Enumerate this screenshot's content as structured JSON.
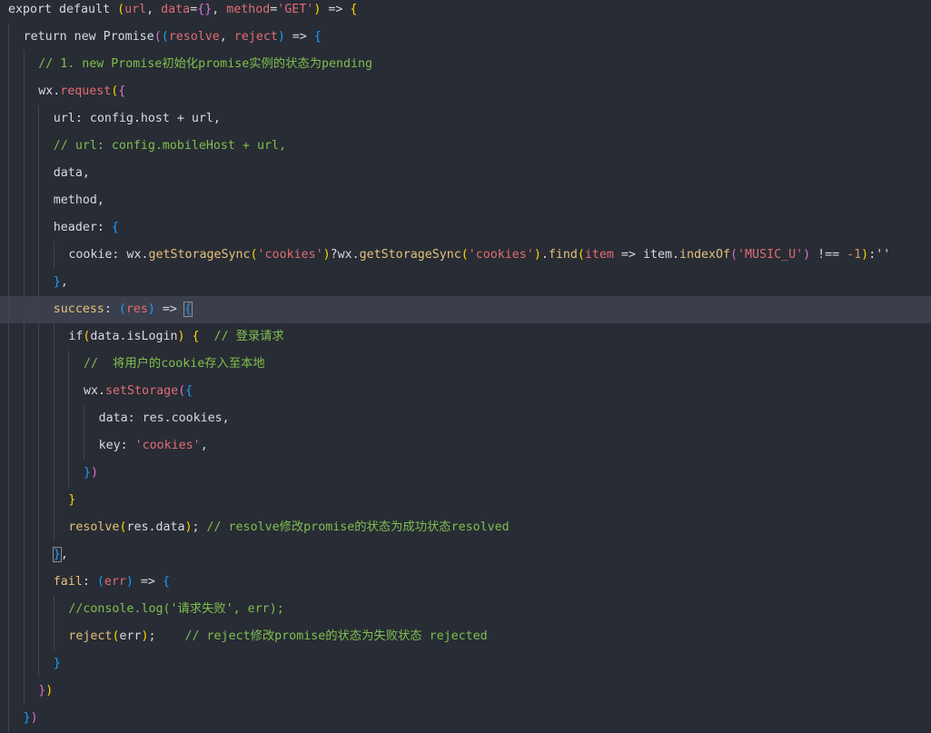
{
  "editor": {
    "active_line_index": 11,
    "lines": [
      {
        "indent": 0,
        "tokens": [
          {
            "t": "export default ",
            "c": "plain"
          },
          {
            "t": "(",
            "c": "brk"
          },
          {
            "t": "url",
            "c": "prm"
          },
          {
            "t": ", ",
            "c": "plain"
          },
          {
            "t": "data",
            "c": "prm"
          },
          {
            "t": "=",
            "c": "plain"
          },
          {
            "t": "{}",
            "c": "brk2"
          },
          {
            "t": ", ",
            "c": "plain"
          },
          {
            "t": "method",
            "c": "prm"
          },
          {
            "t": "=",
            "c": "plain"
          },
          {
            "t": "'GET'",
            "c": "str"
          },
          {
            "t": ")",
            "c": "brk"
          },
          {
            "t": " => ",
            "c": "plain"
          },
          {
            "t": "{",
            "c": "brk"
          }
        ]
      },
      {
        "indent": 1,
        "tokens": [
          {
            "t": "return new Promise",
            "c": "plain"
          },
          {
            "t": "(",
            "c": "brk2"
          },
          {
            "t": "(",
            "c": "brk3"
          },
          {
            "t": "resolve",
            "c": "prm"
          },
          {
            "t": ", ",
            "c": "plain"
          },
          {
            "t": "reject",
            "c": "prm"
          },
          {
            "t": ")",
            "c": "brk3"
          },
          {
            "t": " => ",
            "c": "plain"
          },
          {
            "t": "{",
            "c": "brk3"
          }
        ]
      },
      {
        "indent": 2,
        "tokens": [
          {
            "t": "// 1. new Promise初始化promise实例的状态为pending",
            "c": "cmt"
          }
        ]
      },
      {
        "indent": 2,
        "tokens": [
          {
            "t": "wx.",
            "c": "plain"
          },
          {
            "t": "request",
            "c": "str"
          },
          {
            "t": "(",
            "c": "brk"
          },
          {
            "t": "{",
            "c": "brk2"
          }
        ]
      },
      {
        "indent": 3,
        "tokens": [
          {
            "t": "url: config.host ",
            "c": "plain"
          },
          {
            "t": "+",
            "c": "plain"
          },
          {
            "t": " url,",
            "c": "plain"
          }
        ]
      },
      {
        "indent": 3,
        "tokens": [
          {
            "t": "// url: config.mobileHost + url,",
            "c": "cmt"
          }
        ]
      },
      {
        "indent": 3,
        "tokens": [
          {
            "t": "data,",
            "c": "plain"
          }
        ]
      },
      {
        "indent": 3,
        "tokens": [
          {
            "t": "method,",
            "c": "plain"
          }
        ]
      },
      {
        "indent": 3,
        "tokens": [
          {
            "t": "header: ",
            "c": "plain"
          },
          {
            "t": "{",
            "c": "brk3"
          }
        ]
      },
      {
        "indent": 4,
        "tokens": [
          {
            "t": "cookie: wx.",
            "c": "plain"
          },
          {
            "t": "getStorageSync",
            "c": "fn"
          },
          {
            "t": "(",
            "c": "brk"
          },
          {
            "t": "'cookies'",
            "c": "str"
          },
          {
            "t": ")",
            "c": "brk"
          },
          {
            "t": "?wx.",
            "c": "plain"
          },
          {
            "t": "getStorageSync",
            "c": "fn"
          },
          {
            "t": "(",
            "c": "brk"
          },
          {
            "t": "'cookies'",
            "c": "str"
          },
          {
            "t": ")",
            "c": "brk"
          },
          {
            "t": ".",
            "c": "plain"
          },
          {
            "t": "find",
            "c": "fn"
          },
          {
            "t": "(",
            "c": "brk"
          },
          {
            "t": "item",
            "c": "prm"
          },
          {
            "t": " => item.",
            "c": "plain"
          },
          {
            "t": "indexOf",
            "c": "fn"
          },
          {
            "t": "(",
            "c": "brk2"
          },
          {
            "t": "'MUSIC_U'",
            "c": "str"
          },
          {
            "t": ")",
            "c": "brk2"
          },
          {
            "t": " !== ",
            "c": "plain"
          },
          {
            "t": "-1",
            "c": "num"
          },
          {
            "t": ")",
            "c": "brk"
          },
          {
            "t": ":''",
            "c": "plain"
          }
        ]
      },
      {
        "indent": 3,
        "tokens": [
          {
            "t": "}",
            "c": "brk3"
          },
          {
            "t": ",",
            "c": "plain"
          }
        ]
      },
      {
        "indent": 3,
        "tokens": [
          {
            "t": "success",
            "c": "fn"
          },
          {
            "t": ": ",
            "c": "plain"
          },
          {
            "t": "(",
            "c": "brk3"
          },
          {
            "t": "res",
            "c": "prm"
          },
          {
            "t": ")",
            "c": "brk3"
          },
          {
            "t": " => ",
            "c": "plain"
          },
          {
            "t": "{",
            "c": "brk3",
            "box": true
          }
        ]
      },
      {
        "indent": 4,
        "tokens": [
          {
            "t": "if",
            "c": "plain"
          },
          {
            "t": "(",
            "c": "brk"
          },
          {
            "t": "data.isLogin",
            "c": "plain"
          },
          {
            "t": ")",
            "c": "brk"
          },
          {
            "t": " ",
            "c": "plain"
          },
          {
            "t": "{",
            "c": "brk"
          },
          {
            "t": "  // 登录请求",
            "c": "cmt"
          }
        ]
      },
      {
        "indent": 5,
        "tokens": [
          {
            "t": "//  将用户的cookie存入至本地",
            "c": "cmt"
          }
        ]
      },
      {
        "indent": 5,
        "tokens": [
          {
            "t": "wx.",
            "c": "plain"
          },
          {
            "t": "setStorage",
            "c": "str"
          },
          {
            "t": "(",
            "c": "brk2"
          },
          {
            "t": "{",
            "c": "brk3"
          }
        ]
      },
      {
        "indent": 6,
        "tokens": [
          {
            "t": "data: res.cookies,",
            "c": "plain"
          }
        ]
      },
      {
        "indent": 6,
        "tokens": [
          {
            "t": "key: ",
            "c": "plain"
          },
          {
            "t": "'cookies'",
            "c": "str"
          },
          {
            "t": ",",
            "c": "plain"
          }
        ]
      },
      {
        "indent": 5,
        "tokens": [
          {
            "t": "}",
            "c": "brk3"
          },
          {
            "t": ")",
            "c": "brk2"
          }
        ]
      },
      {
        "indent": 4,
        "tokens": [
          {
            "t": "}",
            "c": "brk"
          }
        ]
      },
      {
        "indent": 4,
        "tokens": [
          {
            "t": "resolve",
            "c": "fn"
          },
          {
            "t": "(",
            "c": "brk"
          },
          {
            "t": "res.data",
            "c": "plain"
          },
          {
            "t": ")",
            "c": "brk"
          },
          {
            "t": "; ",
            "c": "plain"
          },
          {
            "t": "// resolve修改promise的状态为成功状态resolved",
            "c": "cmt"
          }
        ]
      },
      {
        "indent": 3,
        "tokens": [
          {
            "t": "}",
            "c": "brk3",
            "box": true
          },
          {
            "t": ",",
            "c": "plain"
          }
        ]
      },
      {
        "indent": 3,
        "tokens": [
          {
            "t": "fail",
            "c": "fn"
          },
          {
            "t": ": ",
            "c": "plain"
          },
          {
            "t": "(",
            "c": "brk3"
          },
          {
            "t": "err",
            "c": "prm"
          },
          {
            "t": ")",
            "c": "brk3"
          },
          {
            "t": " => ",
            "c": "plain"
          },
          {
            "t": "{",
            "c": "brk3"
          }
        ]
      },
      {
        "indent": 4,
        "tokens": [
          {
            "t": "//console.log('请求失败', err);",
            "c": "cmt"
          }
        ]
      },
      {
        "indent": 4,
        "tokens": [
          {
            "t": "reject",
            "c": "fn"
          },
          {
            "t": "(",
            "c": "brk"
          },
          {
            "t": "err",
            "c": "plain"
          },
          {
            "t": ")",
            "c": "brk"
          },
          {
            "t": ";    ",
            "c": "plain"
          },
          {
            "t": "// reject修改promise的状态为失败状态 rejected",
            "c": "cmt"
          }
        ]
      },
      {
        "indent": 3,
        "tokens": [
          {
            "t": "}",
            "c": "brk3"
          }
        ]
      },
      {
        "indent": 2,
        "tokens": [
          {
            "t": "}",
            "c": "brk2"
          },
          {
            "t": ")",
            "c": "brk"
          }
        ]
      },
      {
        "indent": 1,
        "tokens": [
          {
            "t": "}",
            "c": "brk3"
          },
          {
            "t": ")",
            "c": "brk2"
          }
        ]
      }
    ]
  }
}
